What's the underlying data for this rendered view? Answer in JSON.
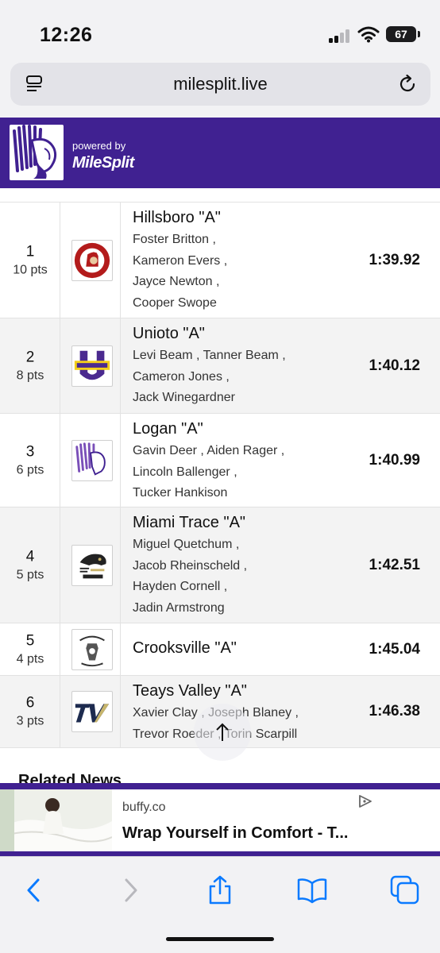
{
  "status_bar": {
    "time": "12:26",
    "battery": "67"
  },
  "browser": {
    "url": "milesplit.live"
  },
  "site_header": {
    "powered_by": "powered by",
    "brand": "MileSplit"
  },
  "results": [
    {
      "place": "1",
      "points": "10 pts",
      "team": "Hillsboro \"A\"",
      "athletes": [
        "Foster Britton ,",
        "Kameron Evers ,",
        "Jayce Newton ,",
        "Cooper Swope"
      ],
      "time": "1:39.92"
    },
    {
      "place": "2",
      "points": "8 pts",
      "team": "Unioto \"A\"",
      "athletes": [
        "Levi Beam , Tanner Beam ,",
        "Cameron Jones ,",
        "Jack Winegardner"
      ],
      "time": "1:40.12"
    },
    {
      "place": "3",
      "points": "6 pts",
      "team": "Logan \"A\"",
      "athletes": [
        "Gavin Deer , Aiden Rager ,",
        "Lincoln Ballenger ,",
        "Tucker Hankison"
      ],
      "time": "1:40.99"
    },
    {
      "place": "4",
      "points": "5 pts",
      "team": "Miami Trace \"A\"",
      "athletes": [
        "Miguel Quetchum ,",
        "Jacob Rheinscheld ,",
        "Hayden Cornell ,",
        "Jadin Armstrong"
      ],
      "time": "1:42.51"
    },
    {
      "place": "5",
      "points": "4 pts",
      "team": "Crooksville \"A\"",
      "athletes": [],
      "time": "1:45.04"
    },
    {
      "place": "6",
      "points": "3 pts",
      "team": "Teays Valley \"A\"",
      "athletes": [
        "Xavier Clay , Joseph Blaney ,",
        "Trevor Roeder , Torin Scarpill"
      ],
      "time": "1:46.38"
    }
  ],
  "related_news_heading": "Related News",
  "ad": {
    "domain": "buffy.co",
    "title": "Wrap Yourself in Comfort - T..."
  },
  "colors": {
    "brand_purple": "#402191",
    "chrome_gray": "#f2f2f4",
    "ios_blue": "#0a7aff"
  },
  "icons": [
    "signal-icon",
    "wifi-icon",
    "battery-icon",
    "reader-icon",
    "reload-icon",
    "scroll-up-icon",
    "ad-choices-icon",
    "back-icon",
    "forward-icon",
    "share-icon",
    "bookmarks-icon",
    "tabs-icon"
  ]
}
